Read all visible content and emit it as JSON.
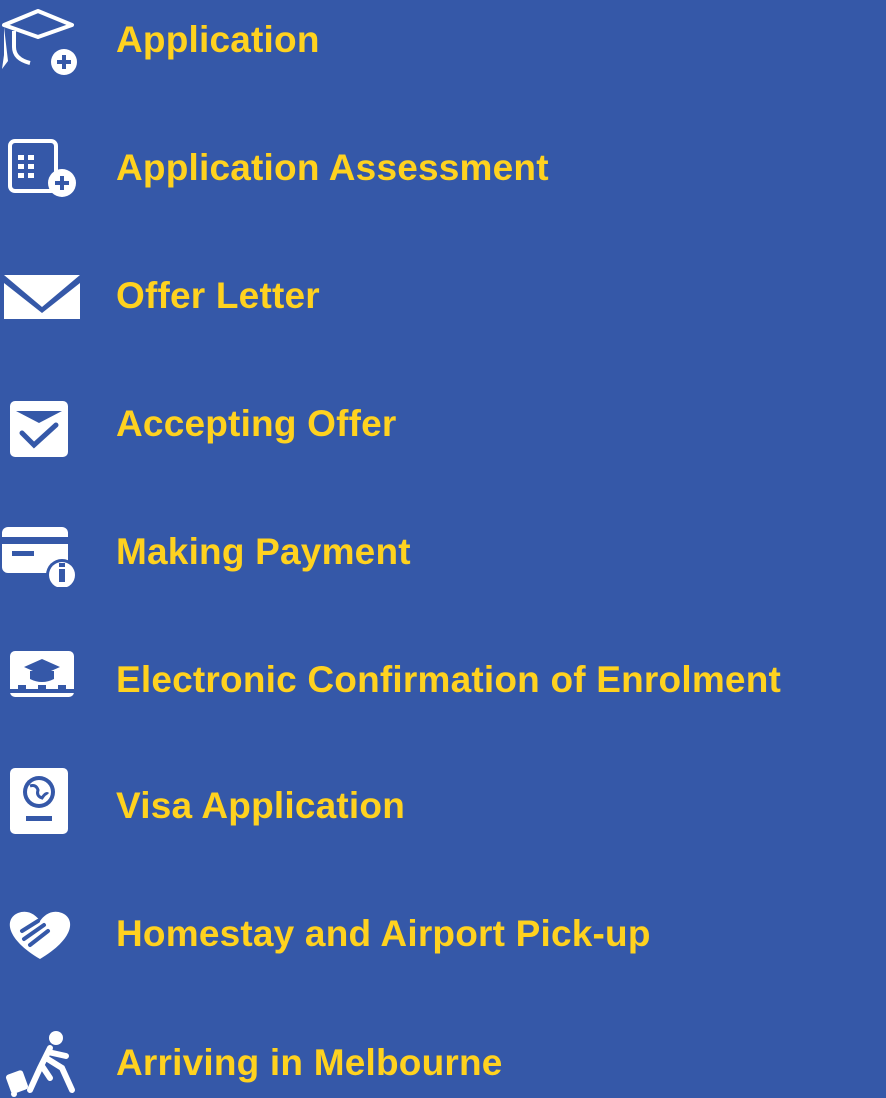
{
  "colors": {
    "background": "#3558a8",
    "accent": "#ffd21f",
    "icon": "#ffffff"
  },
  "steps": [
    {
      "label": "Application",
      "icon": "graduation-cap-add-icon"
    },
    {
      "label": "Application Assessment",
      "icon": "document-add-icon"
    },
    {
      "label": "Offer Letter",
      "icon": "envelope-icon"
    },
    {
      "label": "Accepting Offer",
      "icon": "inbox-check-icon"
    },
    {
      "label": "Making Payment",
      "icon": "card-info-icon"
    },
    {
      "label": "Electronic Confirmation of Enrolment",
      "icon": "graduation-board-icon"
    },
    {
      "label": "Visa Application",
      "icon": "passport-icon"
    },
    {
      "label": "Homestay and Airport Pick-up",
      "icon": "heart-hand-icon"
    },
    {
      "label": "Arriving in Melbourne",
      "icon": "traveller-luggage-icon"
    }
  ]
}
